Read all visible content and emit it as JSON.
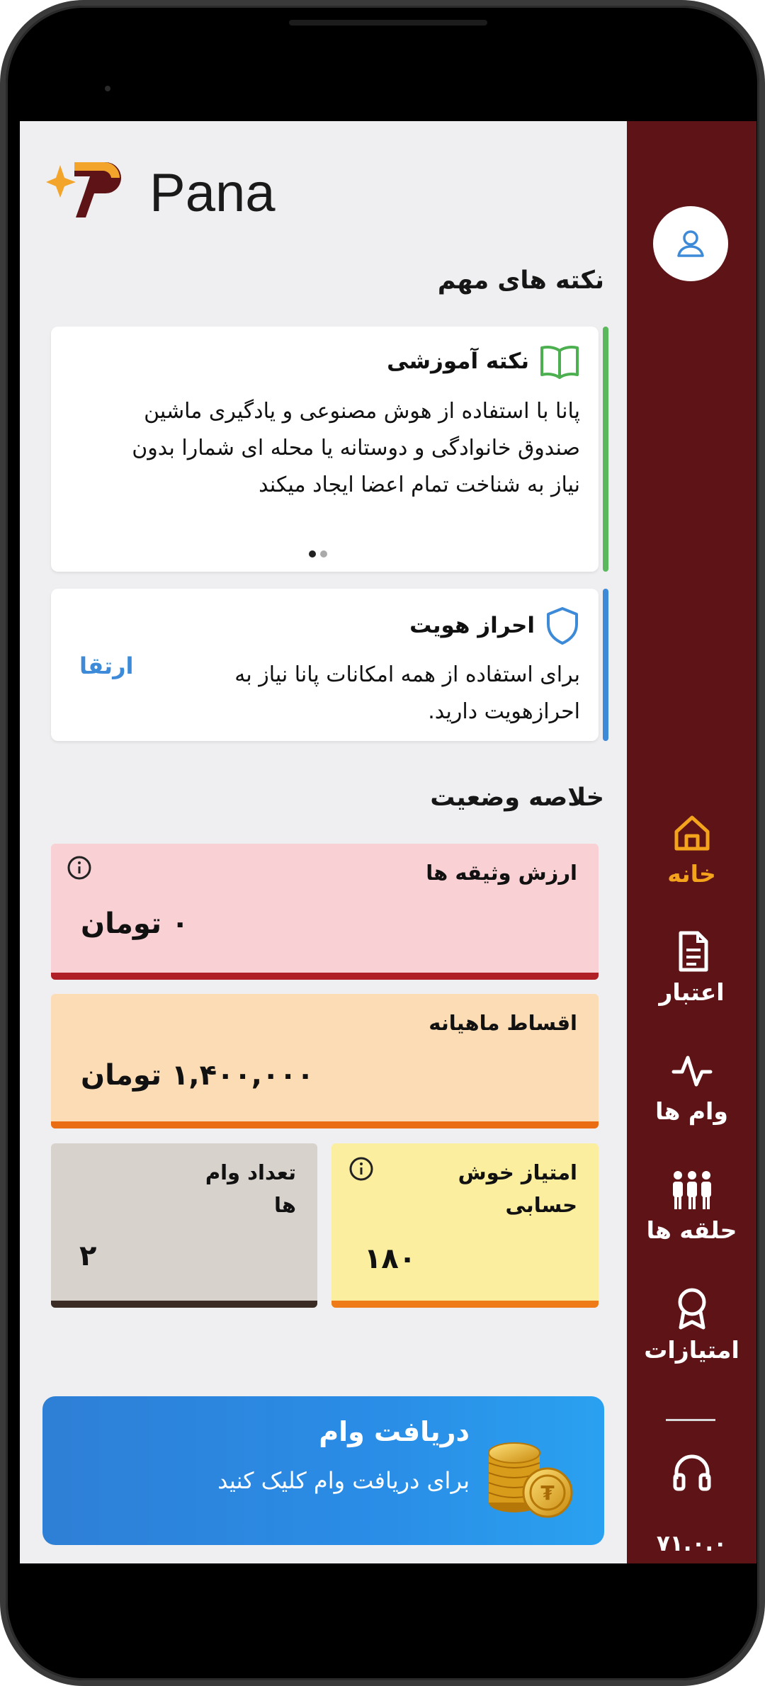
{
  "app": {
    "logo_text": "Pana",
    "version": "V1.0.0",
    "version_display": "۷۱.۰.۰"
  },
  "sidebar": {
    "items": [
      {
        "label": "خانه",
        "icon": "home-icon",
        "active": true
      },
      {
        "label": "اعتبار",
        "icon": "document-icon",
        "active": false
      },
      {
        "label": "وام ها",
        "icon": "activity-icon",
        "active": false
      },
      {
        "label": "حلقه ها",
        "icon": "people-icon",
        "active": false
      },
      {
        "label": "امتیازات",
        "icon": "award-icon",
        "active": false
      }
    ],
    "support_icon": "headphones-icon"
  },
  "tips": {
    "title": "نکته های مهم",
    "education_card": {
      "title": "نکته آموزشی",
      "icon": "book-icon",
      "body": "پانا با استفاده از هوش مصنوعی و یادگیری ماشین صندوق خانوادگی و دوستانه یا محله ای شمارا بدون نیاز به شناخت تمام اعضا ایجاد میکند",
      "accent": "#5cb85c"
    },
    "identity_card": {
      "title": "احراز هویت",
      "icon": "shield-icon",
      "body": "برای استفاده از همه امکانات پانا نیاز به احرازهویت دارید.",
      "action": "ارتقا",
      "accent": "#3d8bd8"
    }
  },
  "summary": {
    "title": "خلاصه وضعیت",
    "collateral": {
      "title": "ارزش وثیقه ها",
      "value": "۰ تومان",
      "bg": "#f9d0d3",
      "accent": "#b11f26"
    },
    "installments": {
      "title": "اقساط ماهیانه",
      "value": "۱,۴۰۰,۰۰۰ تومان",
      "bg": "#fbdcb4",
      "accent": "#ea6d13"
    },
    "score": {
      "title": "امتیاز خوش حسابی",
      "value": "۱۸۰",
      "bg": "#fbee9f",
      "accent": "#ee7b17"
    },
    "loans_count": {
      "title": "تعداد وام ها",
      "value": "۲",
      "bg": "#d8d2cd",
      "accent": "#3a2c24"
    }
  },
  "banner": {
    "title": "دریافت وام",
    "subtitle": "برای دریافت وام کلیک کنید",
    "icon": "coins-icon"
  }
}
